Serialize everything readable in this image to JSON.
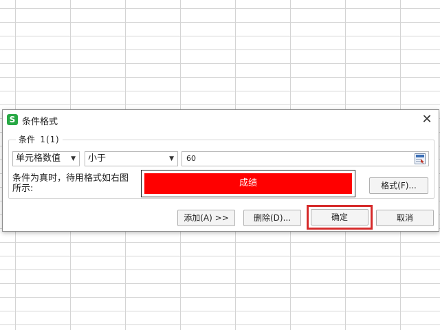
{
  "dialog": {
    "title": "条件格式",
    "app_icon_letter": "S",
    "close_symbol": "✕"
  },
  "condition": {
    "group_label": "条件 1(1)",
    "type_select": {
      "value": "单元格数值",
      "arrow": "▼"
    },
    "operator_select": {
      "value": "小于",
      "arrow": "▼"
    },
    "value_input": "60"
  },
  "preview": {
    "label": "条件为真时，待用格式如右图所示:",
    "sample_text": "成绩",
    "fill_color": "#ff0000",
    "text_color": "#ffffff"
  },
  "buttons": {
    "format": "格式(F)...",
    "add": "添加(A) >>",
    "delete": "删除(D)...",
    "ok": "确定",
    "cancel": "取消"
  },
  "colors": {
    "highlight": "#d62a2a",
    "app_icon": "#27a844"
  }
}
